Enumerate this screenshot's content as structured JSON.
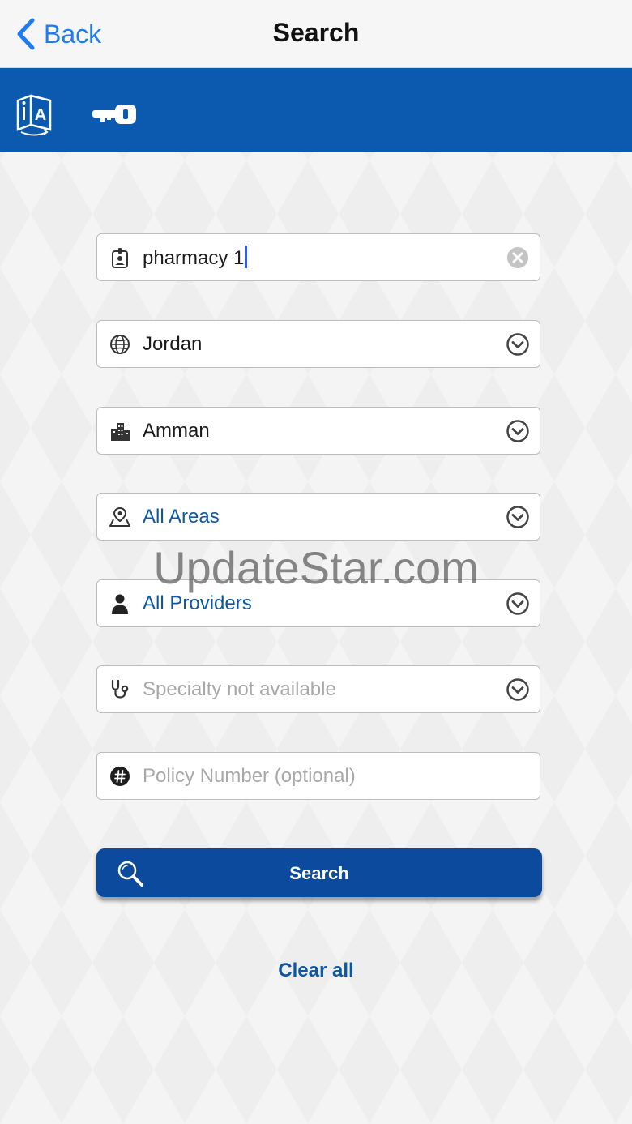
{
  "nav": {
    "back_label": "Back",
    "title": "Search"
  },
  "toolbar": {
    "icons": [
      "language-icon",
      "key-icon"
    ]
  },
  "form": {
    "name_field": {
      "value": "pharmacy 1",
      "icon": "id-badge-icon"
    },
    "country": {
      "value": "Jordan",
      "icon": "globe-icon"
    },
    "city": {
      "value": "Amman",
      "icon": "city-buildings-icon"
    },
    "area": {
      "value": "All Areas",
      "icon": "map-pin-icon"
    },
    "provider": {
      "value": "All Providers",
      "icon": "person-icon"
    },
    "specialty": {
      "placeholder": "Specialty not available",
      "icon": "stethoscope-icon"
    },
    "policy": {
      "placeholder": "Policy Number (optional)",
      "icon": "hash-icon"
    }
  },
  "search_label": "Search",
  "clear_label": "Clear all",
  "watermark": "UpdateStar.com",
  "colors": {
    "toolbar": "#0b5aaf",
    "button": "#0b4a9d",
    "link": "#0c57a6",
    "ios_blue": "#1f7bf2"
  }
}
